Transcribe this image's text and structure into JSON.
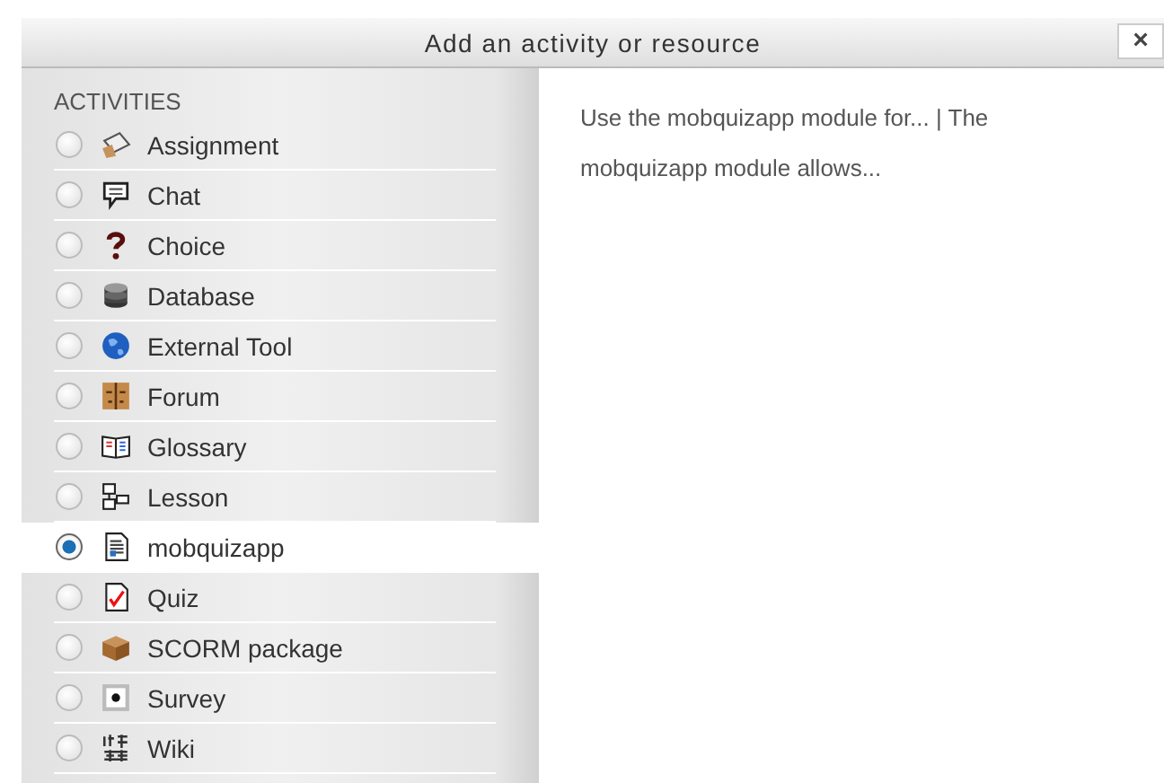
{
  "dialog": {
    "title": "Add an activity or resource",
    "close": "×"
  },
  "section_heading": "ACTIVITIES",
  "items": [
    {
      "label": "Assignment",
      "selected": false
    },
    {
      "label": "Chat",
      "selected": false
    },
    {
      "label": "Choice",
      "selected": false
    },
    {
      "label": "Database",
      "selected": false
    },
    {
      "label": "External Tool",
      "selected": false
    },
    {
      "label": "Forum",
      "selected": false
    },
    {
      "label": "Glossary",
      "selected": false
    },
    {
      "label": "Lesson",
      "selected": false
    },
    {
      "label": "mobquizapp",
      "selected": true
    },
    {
      "label": "Quiz",
      "selected": false
    },
    {
      "label": "SCORM package",
      "selected": false
    },
    {
      "label": "Survey",
      "selected": false
    },
    {
      "label": "Wiki",
      "selected": false
    }
  ],
  "description": "Use the mobquizapp module for... | The mobquizapp module allows..."
}
